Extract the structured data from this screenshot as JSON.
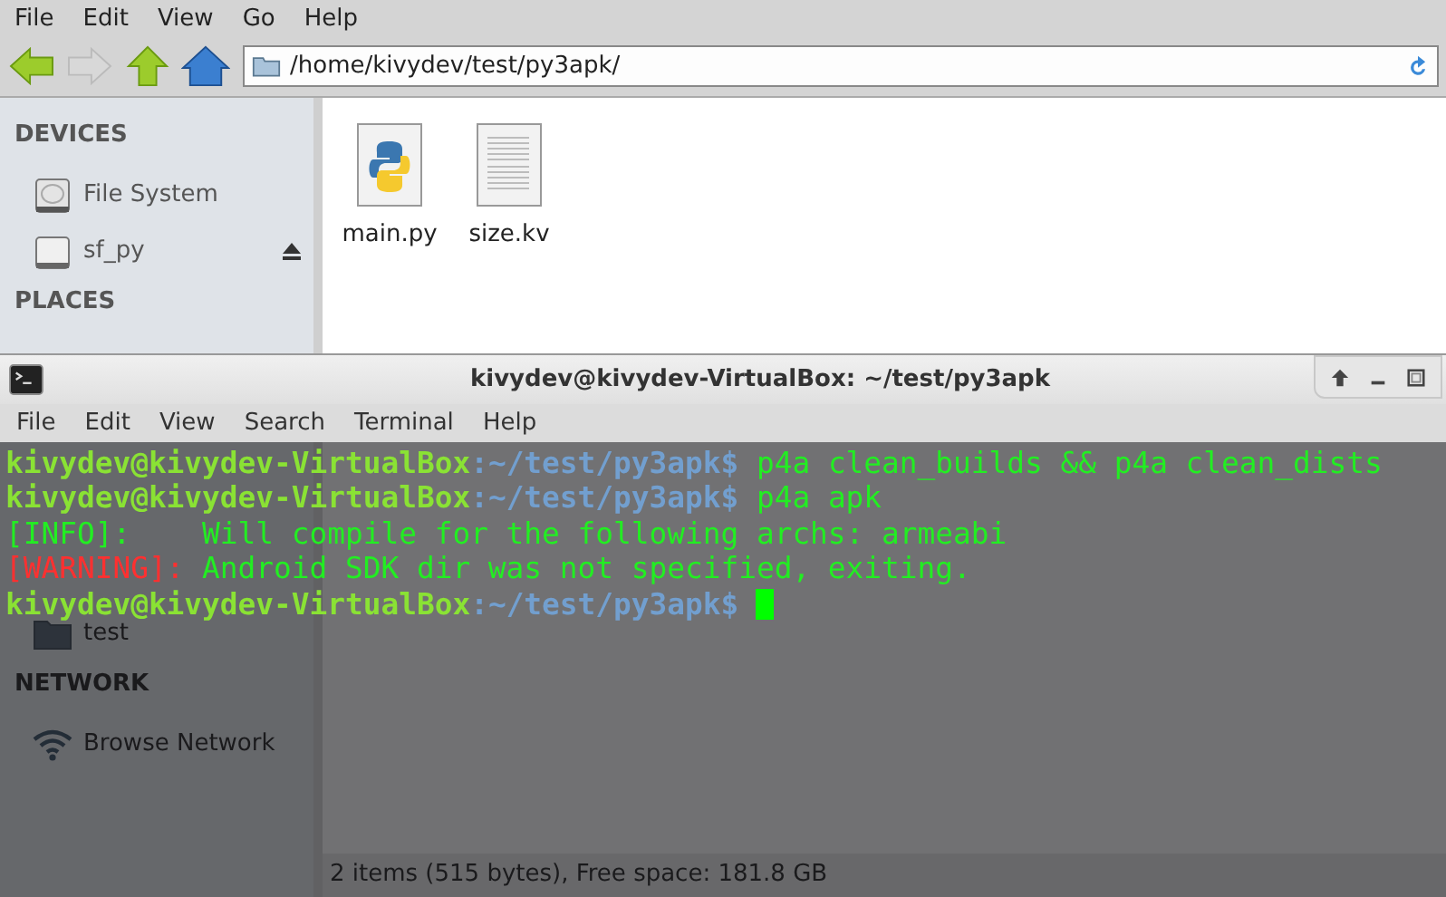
{
  "file_manager": {
    "menu": [
      "File",
      "Edit",
      "View",
      "Go",
      "Help"
    ],
    "toolbar": [
      {
        "kind": "back",
        "disabled": false
      },
      {
        "kind": "forward",
        "disabled": true
      },
      {
        "kind": "up",
        "disabled": false
      },
      {
        "kind": "home",
        "disabled": false
      }
    ],
    "address": "/home/kivydev/test/py3apk/",
    "sidebar": [
      {
        "heading": "DEVICES",
        "items": [
          {
            "label": "File System",
            "kind": "drive",
            "eject": false
          },
          {
            "label": "sf_py",
            "kind": "removable",
            "eject": true
          }
        ]
      },
      {
        "heading": "PLACES",
        "items": [
          {
            "label": "test",
            "kind": "folder",
            "eject": false
          }
        ]
      },
      {
        "heading": "NETWORK",
        "items": [
          {
            "label": "Browse Network",
            "kind": "network",
            "eject": false
          }
        ]
      }
    ],
    "files": [
      {
        "name": "main.py",
        "kind": "python"
      },
      {
        "name": "size.kv",
        "kind": "text"
      }
    ],
    "status_bar": "2 items (515 bytes), Free space: 181.8 GB"
  },
  "terminal": {
    "title": "kivydev@kivydev-VirtualBox: ~/test/py3apk",
    "menu": [
      "File",
      "Edit",
      "View",
      "Search",
      "Terminal",
      "Help"
    ],
    "lines": [
      {
        "kind": "prompt",
        "host": "kivydev@kivydev-VirtualBox",
        "path": ":~/test/py3apk$",
        "command": "p4a clean_builds && p4a clean_dists"
      },
      {
        "kind": "prompt",
        "host": "kivydev@kivydev-VirtualBox",
        "path": ":~/test/py3apk$",
        "command": "p4a apk"
      },
      {
        "kind": "info",
        "tag": "[INFO]:",
        "message": "Will compile for the following archs: armeabi"
      },
      {
        "kind": "warning",
        "tag": "[WARNING]:",
        "message": "Android SDK dir was not specified, exiting."
      },
      {
        "kind": "input",
        "host": "kivydev@kivydev-VirtualBox",
        "path": ":~/test/py3apk$"
      }
    ]
  }
}
